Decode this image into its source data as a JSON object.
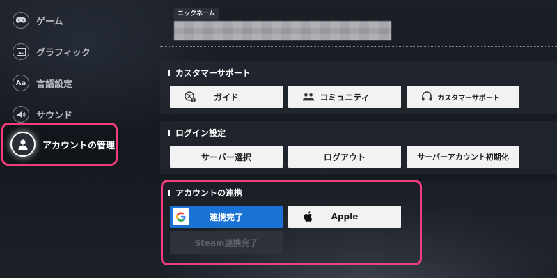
{
  "sidebar": {
    "items": [
      {
        "label": "ゲーム",
        "icon": "gamepad-icon"
      },
      {
        "label": "グラフィック",
        "icon": "image-icon"
      },
      {
        "label": "言語設定",
        "icon": "language-icon",
        "icon_text": "Aa"
      },
      {
        "label": "サウンド",
        "icon": "speaker-icon"
      },
      {
        "label": "アカウントの管理",
        "icon": "user-icon",
        "active": true
      }
    ]
  },
  "profile": {
    "nickname_label": "ニックネーム",
    "nickname_value": ""
  },
  "support": {
    "title": "カスタマーサポート",
    "buttons": [
      {
        "label": "ガイド",
        "icon": "guide-icon"
      },
      {
        "label": "コミュニティ",
        "icon": "community-icon"
      },
      {
        "label": "カスタマーサポート",
        "icon": "headset-icon"
      }
    ]
  },
  "login": {
    "title": "ログイン設定",
    "buttons": [
      {
        "label": "サーバー選択"
      },
      {
        "label": "ログアウト"
      },
      {
        "label": "サーバーアカウント初期化"
      }
    ]
  },
  "link": {
    "title": "アカウントの連携",
    "google": {
      "label": "連携完了",
      "icon": "google-icon",
      "icon_text": "G"
    },
    "apple": {
      "label": "Apple",
      "icon": "apple-icon"
    },
    "steam": {
      "label": "Steam連携完了"
    }
  },
  "colors": {
    "highlight": "#f43d7c",
    "linked_blue": "#1a72d4",
    "button_bg": "#f2f2f2"
  }
}
